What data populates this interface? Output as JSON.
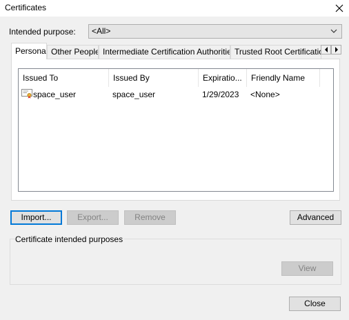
{
  "window": {
    "title": "Certificates"
  },
  "purpose": {
    "label": "Intended purpose:",
    "value": "<All>"
  },
  "tabs": [
    "Personal",
    "Other People",
    "Intermediate Certification Authorities",
    "Trusted Root Certification"
  ],
  "list": {
    "columns": [
      "Issued To",
      "Issued By",
      "Expiratio...",
      "Friendly Name"
    ],
    "rows": [
      {
        "issued_to": "space_user",
        "issued_by": "space_user",
        "expiration": "1/29/2023",
        "friendly_name": "<None>"
      }
    ]
  },
  "buttons": {
    "import": "Import...",
    "export": "Export...",
    "remove": "Remove",
    "advanced": "Advanced",
    "view": "View",
    "close": "Close"
  },
  "purposes_group": {
    "label": "Certificate intended purposes"
  },
  "icons": [
    "close-icon",
    "chevron-down-icon",
    "arrow-left-icon",
    "arrow-right-icon",
    "certificate-icon"
  ]
}
